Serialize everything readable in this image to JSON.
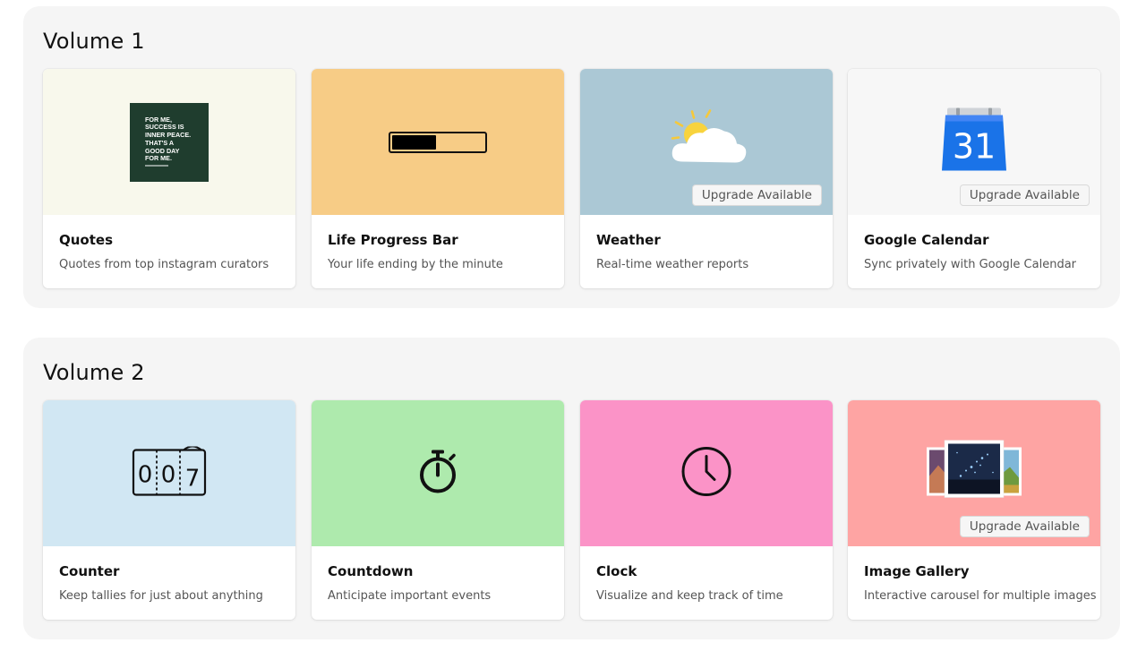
{
  "volumes": [
    {
      "title": "Volume 1",
      "cards": [
        {
          "title": "Quotes",
          "description": "Quotes from top instagram curators",
          "bg": "#f8f8ec",
          "icon": "quote-image",
          "quote_lines": [
            "FOR ME,",
            "SUCCESS IS",
            "INNER PEACE.",
            "THAT'S A",
            "GOOD DAY",
            "FOR ME."
          ]
        },
        {
          "title": "Life Progress Bar",
          "description": "Your life ending by the minute",
          "bg": "#f7cc86",
          "icon": "progress-bar-icon",
          "progress": 0.48
        },
        {
          "title": "Weather",
          "description": "Real-time weather reports",
          "bg": "#abc8d5",
          "icon": "sun-cloud-icon",
          "badge": "Upgrade Available"
        },
        {
          "title": "Google Calendar",
          "description": "Sync privately with Google Calendar",
          "bg": "#f7f7f7",
          "icon": "calendar-icon",
          "calendar_day": "31",
          "badge": "Upgrade Available"
        }
      ]
    },
    {
      "title": "Volume 2",
      "cards": [
        {
          "title": "Counter",
          "description": "Keep tallies for just about anything",
          "bg": "#d1e7f3",
          "icon": "counter-icon",
          "counter_digits": [
            "0",
            "0",
            "7"
          ]
        },
        {
          "title": "Countdown",
          "description": "Anticipate important events",
          "bg": "#aeeaad",
          "icon": "stopwatch-icon"
        },
        {
          "title": "Clock",
          "description": "Visualize and keep track of time",
          "bg": "#fb93c7",
          "icon": "clock-icon"
        },
        {
          "title": "Image Gallery",
          "description": "Interactive carousel for multiple images",
          "bg": "#fea4a3",
          "icon": "image-gallery-icon",
          "badge": "Upgrade Available"
        }
      ]
    }
  ]
}
